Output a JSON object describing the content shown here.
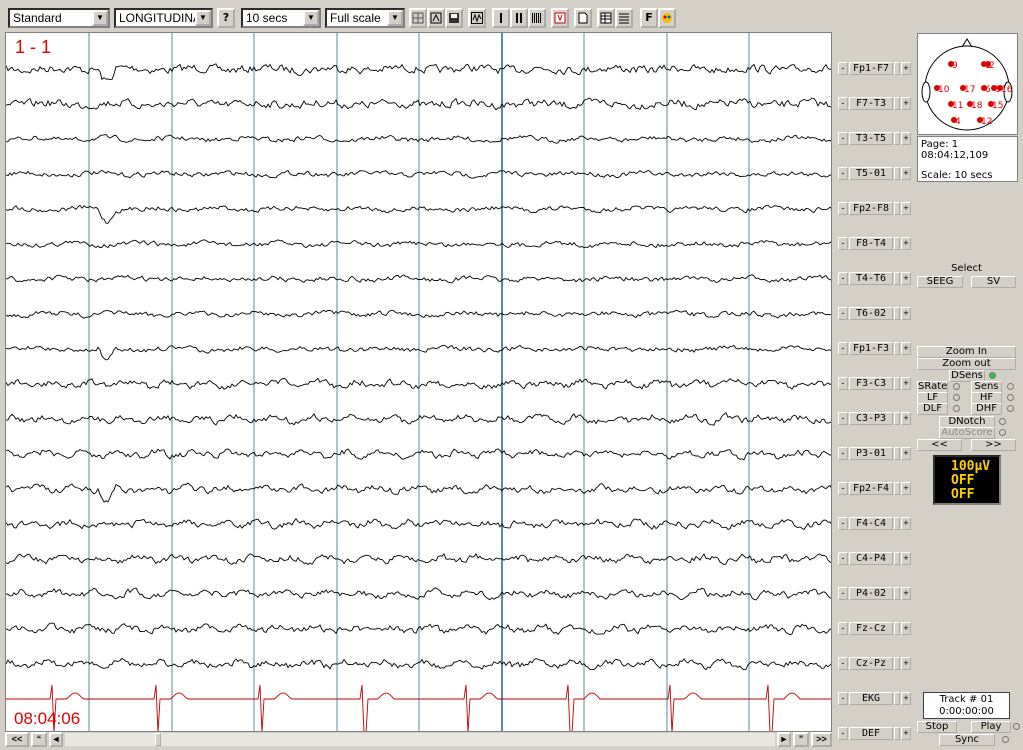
{
  "toolbar": {
    "montage_value": "Standard",
    "montage_type_value": "LONGITUDINA",
    "help_label": "?",
    "timebase_value": "10 secs",
    "scale_value": "Full scale",
    "f_button_label": "F"
  },
  "eeg": {
    "page_label": "1 - 1",
    "time_label": "08:04:06",
    "colors": {
      "trace": "#000000",
      "ekg": "#c00000",
      "grid": "#2a6f8f",
      "label": "#e00000"
    }
  },
  "channels": [
    {
      "label": "Fp1-F7"
    },
    {
      "label": "F7-T3"
    },
    {
      "label": "T3-T5"
    },
    {
      "label": "T5-01"
    },
    {
      "label": "Fp2-F8"
    },
    {
      "label": "F8-T4"
    },
    {
      "label": "T4-T6"
    },
    {
      "label": "T6-02"
    },
    {
      "label": "Fp1-F3"
    },
    {
      "label": "F3-C3"
    },
    {
      "label": "C3-P3"
    },
    {
      "label": "P3-01"
    },
    {
      "label": "Fp2-F4"
    },
    {
      "label": "F4-C4"
    },
    {
      "label": "C4-P4"
    },
    {
      "label": "P4-02"
    },
    {
      "label": "Fz-Cz"
    },
    {
      "label": "Cz-Pz"
    },
    {
      "label": "EKG"
    },
    {
      "label": "DEF"
    }
  ],
  "info": {
    "page": "Page: 1",
    "time": "08:04:12,109",
    "scale": "Scale: 10 secs"
  },
  "controls": {
    "select": "Select",
    "seeg": "SEEG",
    "sv": "SV",
    "zoom_in": "Zoom In",
    "zoom_out": "Zoom out",
    "dsens": "DSens",
    "srate": "SRate",
    "sens": "Sens",
    "lf": "LF",
    "hf": "HF",
    "dlf": "DLF",
    "dhf": "DHF",
    "dnotch": "DNotch",
    "autoscore": "AutoScore",
    "prev": "<<",
    "next": ">>"
  },
  "led_display": {
    "line1": "100µV",
    "line2": "OFF",
    "line3": "OFF"
  },
  "track": {
    "name": "Track # 01",
    "time": "0:00:00:00"
  },
  "playback": {
    "stop": "Stop",
    "play": "Play",
    "sync": "Sync"
  },
  "scroll": {
    "first": "<<",
    "prev": "“",
    "left": "◄",
    "right": "►",
    "next": "”",
    "last": ">>"
  },
  "headmap": {
    "electrodes": [
      "9",
      "1",
      "2",
      "10",
      "17",
      "6",
      "3",
      "11",
      "18",
      "15",
      "4",
      "12",
      "16"
    ]
  }
}
